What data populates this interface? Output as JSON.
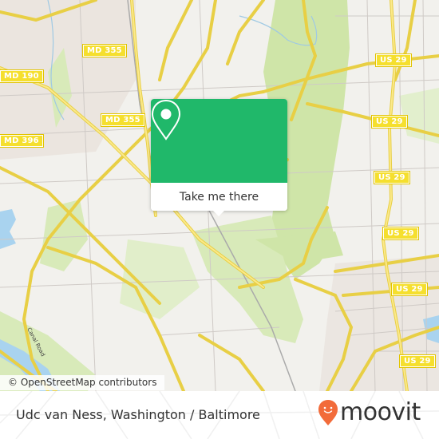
{
  "map": {
    "route_shields": [
      {
        "label": "MD 355",
        "id": "md355-top"
      },
      {
        "label": "MD 190",
        "id": "md190"
      },
      {
        "label": "MD 355",
        "id": "md355-mid"
      },
      {
        "label": "MD 396",
        "id": "md396"
      },
      {
        "label": "US 29",
        "id": "us29-1"
      },
      {
        "label": "US 29",
        "id": "us29-2"
      },
      {
        "label": "US 29",
        "id": "us29-3"
      },
      {
        "label": "US 29",
        "id": "us29-4"
      },
      {
        "label": "US 29",
        "id": "us29-5"
      },
      {
        "label": "US 29",
        "id": "us29-6"
      }
    ],
    "road_label": "Canal Road",
    "colors": {
      "land": "#f2f1ed",
      "park": "#cfe5a8",
      "water": "#a9d3ef",
      "major_road": "#f7df4f",
      "urban": "#e9e3dd"
    }
  },
  "popup": {
    "icon": "location-pin-icon",
    "button_label": "Take me there",
    "accent": "#20b86a"
  },
  "attribution": "© OpenStreetMap contributors",
  "footer": {
    "station": "Udc van Ness, Washington / Baltimore",
    "brand": "moovit",
    "brand_color": "#f26b3a"
  }
}
